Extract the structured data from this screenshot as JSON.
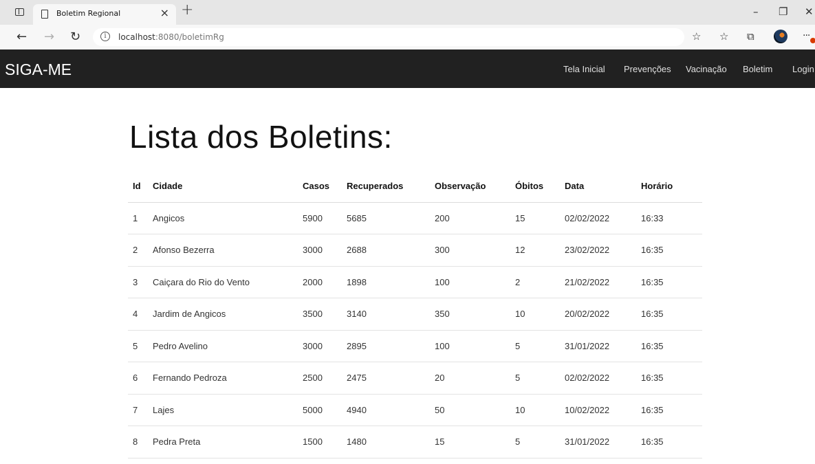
{
  "browser": {
    "tab_title": "Boletim Regional",
    "tab_close": "×",
    "new_tab": "+",
    "url_host": "localhost",
    "url_rest": ":8080/boletimRg",
    "window_controls": {
      "minimize": "–",
      "restore": "❐",
      "close": "✕"
    },
    "nav": {
      "back": "←",
      "forward": "→",
      "reload": "↻"
    },
    "toolbar_icons": [
      "favorite-add-icon",
      "favorites-icon",
      "collections-icon",
      "profile-avatar",
      "more-icon"
    ]
  },
  "navbar": {
    "brand": "SIGA-ME",
    "links": [
      "Tela Inicial",
      "Prevenções",
      "Vacinação",
      "Boletim",
      "Login"
    ]
  },
  "page": {
    "heading": "Lista dos Boletins:",
    "table": {
      "headers": [
        "Id",
        "Cidade",
        "Casos",
        "Recuperados",
        "Observação",
        "Óbitos",
        "Data",
        "Horário"
      ],
      "rows": [
        [
          "1",
          "Angicos",
          "5900",
          "5685",
          "200",
          "15",
          "02/02/2022",
          "16:33"
        ],
        [
          "2",
          "Afonso Bezerra",
          "3000",
          "2688",
          "300",
          "12",
          "23/02/2022",
          "16:35"
        ],
        [
          "3",
          "Caiçara do Rio do Vento",
          "2000",
          "1898",
          "100",
          "2",
          "21/02/2022",
          "16:35"
        ],
        [
          "4",
          "Jardim de Angicos",
          "3500",
          "3140",
          "350",
          "10",
          "20/02/2022",
          "16:35"
        ],
        [
          "5",
          "Pedro Avelino",
          "3000",
          "2895",
          "100",
          "5",
          "31/01/2022",
          "16:35"
        ],
        [
          "6",
          "Fernando Pedroza",
          "2500",
          "2475",
          "20",
          "5",
          "02/02/2022",
          "16:35"
        ],
        [
          "7",
          "Lajes",
          "5000",
          "4940",
          "50",
          "10",
          "10/02/2022",
          "16:35"
        ],
        [
          "8",
          "Pedra Preta",
          "1500",
          "1480",
          "15",
          "5",
          "31/01/2022",
          "16:35"
        ]
      ]
    }
  },
  "colors": {
    "navbar_bg": "#212121",
    "tabstrip_bg": "#e6e6e6",
    "badge": "#d83b01"
  }
}
